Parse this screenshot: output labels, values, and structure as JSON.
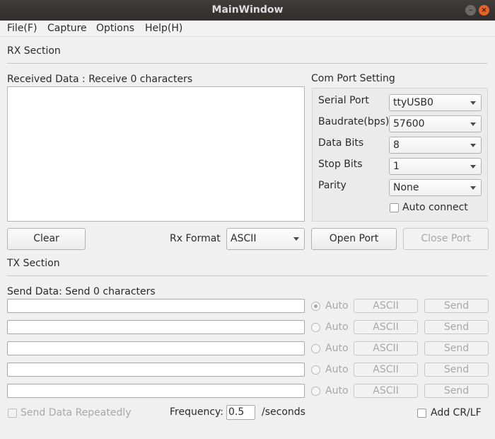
{
  "window": {
    "title": "MainWindow"
  },
  "menu": [
    "File(F)",
    "Capture",
    "Options",
    "Help(H)"
  ],
  "rx": {
    "section_label": "RX Section",
    "received_label": "Received Data : Receive 0 characters",
    "clear_label": "Clear",
    "format_label": "Rx Format",
    "format_value": "ASCII"
  },
  "com": {
    "title": "Com Port Setting",
    "serial_port_label": "Serial Port",
    "serial_port_value": "ttyUSB0",
    "baudrate_label": "Baudrate(bps)",
    "baudrate_value": "57600",
    "data_bits_label": "Data Bits",
    "data_bits_value": "8",
    "stop_bits_label": "Stop Bits",
    "stop_bits_value": "1",
    "parity_label": "Parity",
    "parity_value": "None",
    "auto_connect_label": "Auto connect",
    "open_port_label": "Open Port",
    "close_port_label": "Close Port"
  },
  "tx": {
    "section_label": "TX Section",
    "send_label": "Send Data: Send 0 characters",
    "rows": [
      {
        "value": "",
        "auto_label": "Auto",
        "auto_selected": true,
        "format_label": "ASCII",
        "send_label": "Send"
      },
      {
        "value": "",
        "auto_label": "Auto",
        "auto_selected": false,
        "format_label": "ASCII",
        "send_label": "Send"
      },
      {
        "value": "",
        "auto_label": "Auto",
        "auto_selected": false,
        "format_label": "ASCII",
        "send_label": "Send"
      },
      {
        "value": "",
        "auto_label": "Auto",
        "auto_selected": false,
        "format_label": "ASCII",
        "send_label": "Send"
      },
      {
        "value": "",
        "auto_label": "Auto",
        "auto_selected": false,
        "format_label": "ASCII",
        "send_label": "Send"
      }
    ],
    "repeat_label": "Send Data Repeatedly",
    "frequency_label": "Frequency:",
    "frequency_value": "0.5",
    "seconds_label": "/seconds",
    "crlf_label": "Add CR/LF"
  }
}
